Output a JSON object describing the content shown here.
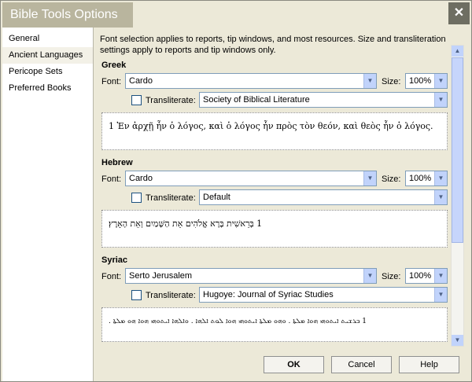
{
  "window": {
    "title": "Bible Tools Options",
    "close_glyph": "✕"
  },
  "sidebar": {
    "items": [
      {
        "label": "General"
      },
      {
        "label": "Ancient Languages"
      },
      {
        "label": "Pericope Sets"
      },
      {
        "label": "Preferred Books"
      }
    ]
  },
  "intro": "Font selection applies to reports, tip windows, and most resources. Size and transliteration settings apply to reports and tip windows only.",
  "labels": {
    "font": "Font:",
    "size": "Size:",
    "transliterate": "Transliterate:"
  },
  "sections": {
    "greek": {
      "title": "Greek",
      "font": "Cardo",
      "size": "100%",
      "transliterate_checked": false,
      "transliterate_value": "Society of Biblical Literature",
      "sample": "1 Ἐν ἀρχῇ ἦν ὁ λόγος, καὶ ὁ λόγος ἦν πρὸς τὸν θεόν, καὶ θεὸς ἦν ὁ λόγος."
    },
    "hebrew": {
      "title": "Hebrew",
      "font": "Cardo",
      "size": "100%",
      "transliterate_checked": false,
      "transliterate_value": "Default",
      "sample": "1 בְּרֵאשִׁית בָּרָא אֱלֹהִים אֵת הַשָּׁמַיִם וְאֵת הָאָרֶץ׃"
    },
    "syriac": {
      "title": "Syriac",
      "font": "Serto Jerusalem",
      "size": "100%",
      "transliterate_checked": false,
      "transliterate_value": "Hugoye: Journal of Syriac Studies",
      "sample": "1 ܒܪܫܝܬ ܐܝܬܘܗܝ ܗܘܐ ܡܠܬܐ . ܘܗܘ ܡܠܬܐ ܐܝܬܘܗܝ ܗܘܐ ܠܘܬ ܐܠܗܐ . ܘܐܠܗܐ ܐܝܬܘܗܝ ܗܘܐ ܗܘ ܡܠܬܐ ."
    }
  },
  "buttons": {
    "ok": "OK",
    "cancel": "Cancel",
    "help": "Help"
  },
  "colors": {
    "title_tab": "#b9b59e",
    "close_btn": "#6e6e62",
    "accent": "#c1d3fb"
  }
}
